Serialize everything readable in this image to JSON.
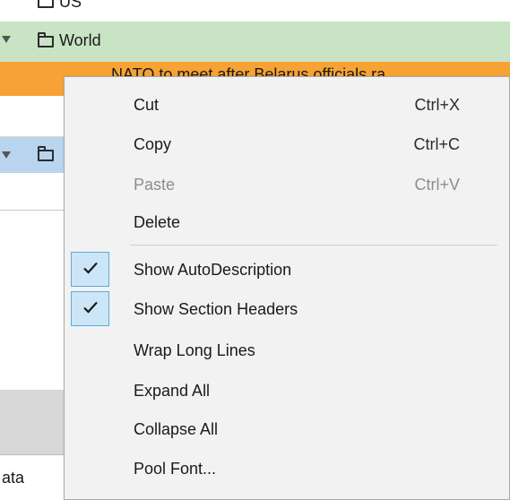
{
  "tree": {
    "row_us_label": "US",
    "row_world_label": "World",
    "row_news_label": "NATO to meet after Belarus officials ra...",
    "status_label": "ata"
  },
  "colors": {
    "green_row": "#c9e4c5",
    "orange_row": "#f7a234",
    "selected_row": "#b9d4ef",
    "check_highlight": "#cde6f7"
  },
  "context_menu": {
    "items": [
      {
        "label": "Cut",
        "shortcut": "Ctrl+X",
        "enabled": true
      },
      {
        "label": "Copy",
        "shortcut": "Ctrl+C",
        "enabled": true
      },
      {
        "label": "Paste",
        "shortcut": "Ctrl+V",
        "enabled": false
      },
      {
        "label": "Delete",
        "shortcut": "",
        "enabled": true
      },
      {
        "label": "Show AutoDescription",
        "checked": true,
        "enabled": true
      },
      {
        "label": "Show Section Headers",
        "checked": true,
        "enabled": true
      },
      {
        "label": "Wrap Long Lines",
        "checked": false,
        "enabled": true
      },
      {
        "label": "Expand All",
        "enabled": true
      },
      {
        "label": "Collapse All",
        "enabled": true
      },
      {
        "label": "Pool Font...",
        "enabled": true
      }
    ]
  }
}
